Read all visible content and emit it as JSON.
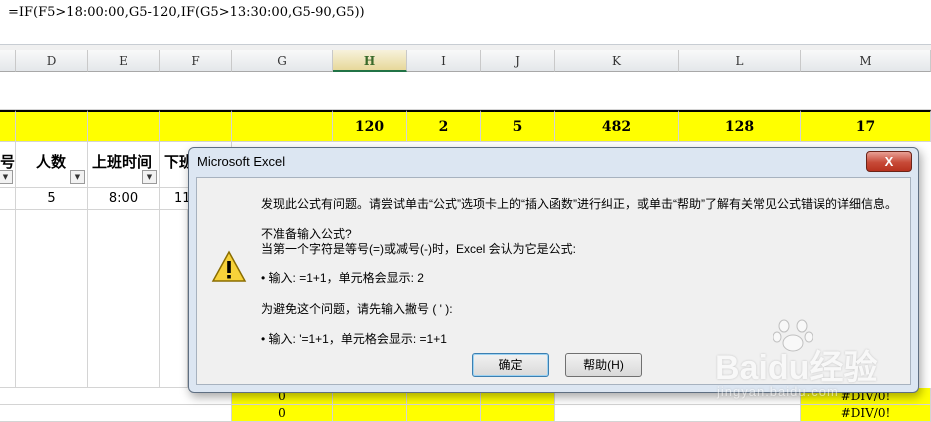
{
  "formula_bar": {
    "formula": "=IF(F5>18:00:00,G5-120,IF(G5>13:30:00,G5-90,G5))"
  },
  "columns": [
    "D",
    "E",
    "F",
    "G",
    "H",
    "I",
    "J",
    "K",
    "L",
    "M"
  ],
  "selected_column": "H",
  "sheet": {
    "totals_row": {
      "H": "120",
      "I": "2",
      "J": "5",
      "K": "482",
      "L": "128",
      "M": "17"
    },
    "header_row": {
      "C_partial": "号",
      "D": "人数",
      "E": "上班时间",
      "F_partial": "下班"
    },
    "data_row": {
      "D": "5",
      "E": "8:00",
      "F_partial": "11"
    },
    "g_zero_values": [
      "0",
      "0"
    ],
    "m_errors": [
      "#DIV/0!",
      "#DIV/0!"
    ]
  },
  "dialog": {
    "title": "Microsoft Excel",
    "close_label": "X",
    "icon": "warning-icon",
    "lines": [
      "发现此公式有问题。请尝试单击“公式”选项卡上的“插入函数”进行纠正，或单击“帮助”了解有关常见公式错误的详细信息。",
      "不准备输入公式?",
      "当第一个字符是等号(=)或减号(-)时，Excel 会认为它是公式:",
      "• 输入: =1+1，单元格会显示: 2",
      "为避免这个问题，请先输入撇号 ( ' ):",
      "• 输入: '=1+1，单元格会显示: =1+1"
    ],
    "ok_label": "确定",
    "help_label": "帮助(H)"
  },
  "watermark": {
    "brand": "Baidu经验",
    "url": "jingyan.baidu.com"
  },
  "colors": {
    "highlight": "#ffff00",
    "dialog_frame": "#dce6f2",
    "close_button": "#c74a38"
  }
}
